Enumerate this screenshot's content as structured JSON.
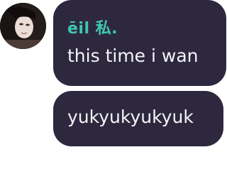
{
  "accent_color": "#3fc7b4",
  "bubble_color": "#2e283f",
  "messages": {
    "username": "ēil 私.",
    "avatar_icon": "user-avatar-photo",
    "first": "this time i wan",
    "second": "yukyukyukyuk"
  }
}
